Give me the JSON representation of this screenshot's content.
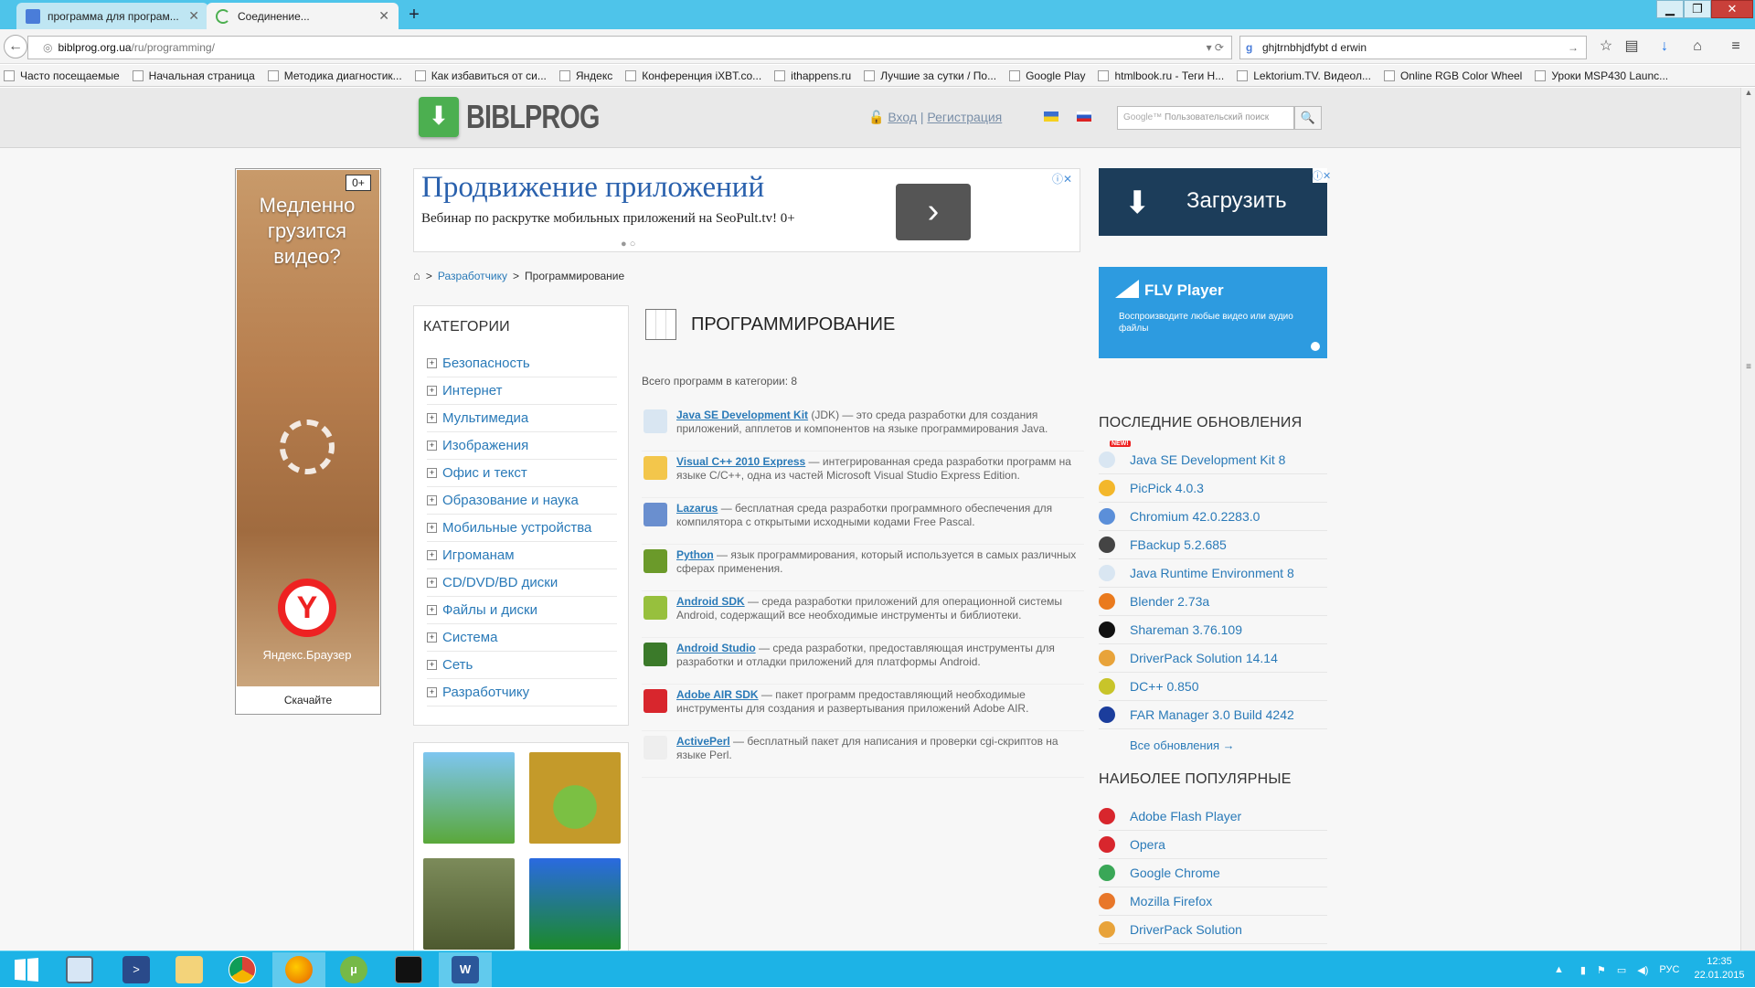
{
  "tabs": [
    {
      "title": "программа для програм...",
      "active": false
    },
    {
      "title": "Соединение...",
      "active": true
    }
  ],
  "url": {
    "host": "biblprog.org.ua",
    "path": "/ru/programming/"
  },
  "search_query": "ghjtrnbhjdfybt d erwin",
  "bookmarks": [
    "Часто посещаемые",
    "Начальная страница",
    "Методика диагностик...",
    "Как избавиться от си...",
    "Яндекс",
    "Конференция iXBT.co...",
    "ithappens.ru",
    "Лучшие за сутки / По...",
    "Google Play",
    "htmlbook.ru - Теги Н...",
    "Lektorium.TV. Видеол...",
    "Online RGB Color Wheel",
    "Уроки MSP430 Launc..."
  ],
  "site": {
    "logo_text": "BIBLPROG",
    "login": "Вход",
    "register": "Регистрация",
    "search_placeholder": "Пользовательский поиск"
  },
  "ad_left": {
    "age": "0+",
    "headline": "Медленно грузится видео?",
    "brand": "Яндекс.Браузер",
    "cta": "Скачайте"
  },
  "ad_top": {
    "title": "Продвижение приложений",
    "subtitle": "Вебинар по раскрутке мобильных приложений на SeoPult.tv! 0+"
  },
  "breadcrumbs": {
    "parent": "Разработчику",
    "current": "Программирование"
  },
  "categories": {
    "title": "КАТЕГОРИИ",
    "items": [
      "Безопасность",
      "Интернет",
      "Мультимедиа",
      "Изображения",
      "Офис и текст",
      "Образование и наука",
      "Мобильные устройства",
      "Игроманам",
      "CD/DVD/BD диски",
      "Файлы и диски",
      "Система",
      "Сеть",
      "Разработчику"
    ]
  },
  "main": {
    "title": "ПРОГРАММИРОВАНИЕ",
    "total_label": "Всего программ в категории:",
    "total": "8",
    "programs": [
      {
        "name": "Java SE Development Kit",
        "desc": " (JDK) — это среда разработки для создания приложений, апплетов и компонентов на языке программирования Java.",
        "color": "#d9e6f2"
      },
      {
        "name": "Visual C++ 2010 Express",
        "desc": " — интегрированная среда разработки программ на языке C/C++, одна из частей Microsoft Visual Studio Express Edition.",
        "color": "#f3c64b"
      },
      {
        "name": "Lazarus",
        "desc": " — бесплатная среда разработки программного обеспечения для компилятора с открытыми исходными кодами Free Pascal.",
        "color": "#6a8fcf"
      },
      {
        "name": "Python",
        "desc": " — язык программирования, который используется в самых различных сферах применения.",
        "color": "#6b9a2a"
      },
      {
        "name": "Android SDK",
        "desc": " — среда разработки приложений для операционной системы Android, содержащий все необходимые инструменты и библиотеки.",
        "color": "#97c03d"
      },
      {
        "name": "Android Studio",
        "desc": " — среда разработки, предоставляющая инструменты для разработки и отладки приложений для платформы Android.",
        "color": "#3b7a2a"
      },
      {
        "name": "Adobe AIR SDK",
        "desc": " — пакет программ предоставляющий необходимые инструменты для создания и развертывания приложений Adobe AIR.",
        "color": "#d8262d"
      },
      {
        "name": "ActivePerl",
        "desc": " — бесплатный пакет для написания и проверки cgi-скриптов на языке Perl.",
        "color": "#eeeeee"
      }
    ]
  },
  "ad_load": {
    "label": "Загрузить"
  },
  "ad_flv": {
    "name": "FLV Player",
    "desc": "Воспроизводите любые видео или аудио файлы"
  },
  "updates": {
    "title": "ПОСЛЕДНИЕ ОБНОВЛЕНИЯ",
    "new_badge": "NEW!",
    "items": [
      {
        "name": "Java SE Development Kit 8",
        "color": "#d9e6f2"
      },
      {
        "name": "PicPick 4.0.3",
        "color": "#f3b72b"
      },
      {
        "name": "Chromium 42.0.2283.0",
        "color": "#5b8fd9"
      },
      {
        "name": "FBackup 5.2.685",
        "color": "#444444"
      },
      {
        "name": "Java Runtime Environment 8",
        "color": "#d9e6f2"
      },
      {
        "name": "Blender 2.73a",
        "color": "#ea7a1d"
      },
      {
        "name": "Shareman 3.76.109",
        "color": "#111111"
      },
      {
        "name": "DriverPack Solution 14.14",
        "color": "#e8a33a"
      },
      {
        "name": "DC++ 0.850",
        "color": "#c8c42a"
      },
      {
        "name": "FAR Manager 3.0 Build 4242",
        "color": "#1b3d9c"
      }
    ],
    "all_link": "Все обновления →"
  },
  "popular": {
    "title": "НАИБОЛЕЕ ПОПУЛЯРНЫЕ",
    "items": [
      {
        "name": "Adobe Flash Player",
        "color": "#d8262d"
      },
      {
        "name": "Opera",
        "color": "#d8262d"
      },
      {
        "name": "Google Chrome",
        "color": "#3aa757"
      },
      {
        "name": "Mozilla Firefox",
        "color": "#e8772a"
      },
      {
        "name": "DriverPack Solution",
        "color": "#e8a33a"
      }
    ]
  },
  "tray": {
    "lang": "РУС",
    "time": "12:35",
    "date": "22.01.2015"
  }
}
